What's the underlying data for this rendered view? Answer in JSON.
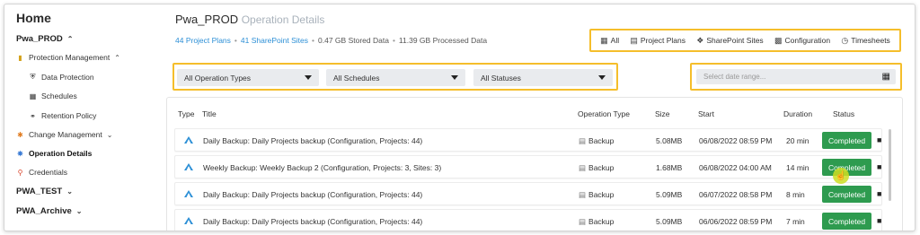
{
  "sidebar": {
    "home": "Home",
    "pwa_prod": "Pwa_PROD",
    "protection_management": "Protection Management",
    "data_protection": "Data Protection",
    "schedules": "Schedules",
    "retention_policy": "Retention Policy",
    "change_management": "Change Management",
    "operation_details": "Operation Details",
    "credentials": "Credentials",
    "pwa_test": "PWA_TEST",
    "pwa_archive": "PWA_Archive"
  },
  "header": {
    "title": "Pwa_PROD",
    "subtitle": "Operation Details",
    "stats": {
      "project_plans": "44 Project Plans",
      "sharepoint_sites": "41 SharePoint Sites",
      "stored": "0.47 GB Stored Data",
      "processed": "11.39 GB Processed Data"
    }
  },
  "tabs": {
    "all": "All",
    "project_plans": "Project Plans",
    "sharepoint_sites": "SharePoint Sites",
    "configuration": "Configuration",
    "timesheets": "Timesheets"
  },
  "filters": {
    "operation_types": "All Operation Types",
    "schedules": "All Schedules",
    "statuses": "All Statuses",
    "date_placeholder": "Select date range..."
  },
  "table": {
    "columns": {
      "type": "Type",
      "title": "Title",
      "operation_type": "Operation Type",
      "size": "Size",
      "start": "Start",
      "duration": "Duration",
      "status": "Status"
    },
    "rows": [
      {
        "title": "Daily Backup: Daily Projects backup (Configuration, Projects: 44)",
        "operation_type": "Backup",
        "size": "5.08MB",
        "start": "06/08/2022 08:59 PM",
        "duration": "20 min",
        "status": "Completed"
      },
      {
        "title": "Weekly Backup: Weekly Backup 2 (Configuration, Projects: 3, Sites: 3)",
        "operation_type": "Backup",
        "size": "1.68MB",
        "start": "06/08/2022 04:00 AM",
        "duration": "14 min",
        "status": "Completed"
      },
      {
        "title": "Daily Backup: Daily Projects backup (Configuration, Projects: 44)",
        "operation_type": "Backup",
        "size": "5.09MB",
        "start": "06/07/2022 08:58 PM",
        "duration": "8 min",
        "status": "Completed"
      },
      {
        "title": "Daily Backup: Daily Projects backup (Configuration, Projects: 44)",
        "operation_type": "Backup",
        "size": "5.09MB",
        "start": "06/06/2022 08:59 PM",
        "duration": "7 min",
        "status": "Completed"
      }
    ]
  },
  "colors": {
    "highlight": "#f5be2b",
    "link": "#2c8fd6",
    "completed": "#2e9b4f"
  }
}
